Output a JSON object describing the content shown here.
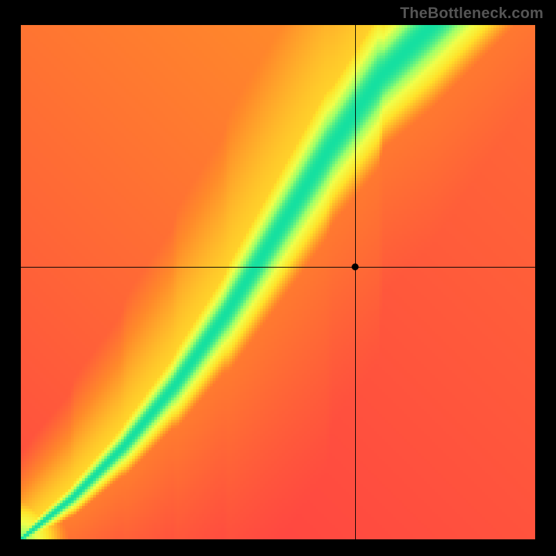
{
  "watermark": "TheBottleneck.com",
  "chart_data": {
    "type": "heatmap",
    "title": "",
    "xlabel": "",
    "ylabel": "",
    "xlim": [
      0,
      100
    ],
    "ylim": [
      0,
      100
    ],
    "color_scale": {
      "stops": [
        {
          "t": 0.0,
          "color": "#ff2a4b"
        },
        {
          "t": 0.35,
          "color": "#ff8a2a"
        },
        {
          "t": 0.6,
          "color": "#ffe22a"
        },
        {
          "t": 0.78,
          "color": "#f0ff4a"
        },
        {
          "t": 0.9,
          "color": "#9eff6a"
        },
        {
          "t": 1.0,
          "color": "#15e0a0"
        }
      ],
      "meaning": "red = strong bottleneck, green = balanced"
    },
    "optimal_curve": {
      "description": "Green diagonal ridge: ideal pairing (y as function of x). Slightly superlinear; widens above midline.",
      "points": [
        {
          "x": 0,
          "y": 0
        },
        {
          "x": 10,
          "y": 8
        },
        {
          "x": 20,
          "y": 18
        },
        {
          "x": 30,
          "y": 30
        },
        {
          "x": 40,
          "y": 44
        },
        {
          "x": 50,
          "y": 60
        },
        {
          "x": 60,
          "y": 76
        },
        {
          "x": 70,
          "y": 90
        },
        {
          "x": 80,
          "y": 100
        }
      ],
      "band_half_width_low": 1.2,
      "band_half_width_high": 9.0
    },
    "crosshair": {
      "x": 65,
      "y": 53
    },
    "marker": {
      "x": 65,
      "y": 53
    },
    "grid": false,
    "legend": null,
    "pixelated": true,
    "resolution": 185
  }
}
